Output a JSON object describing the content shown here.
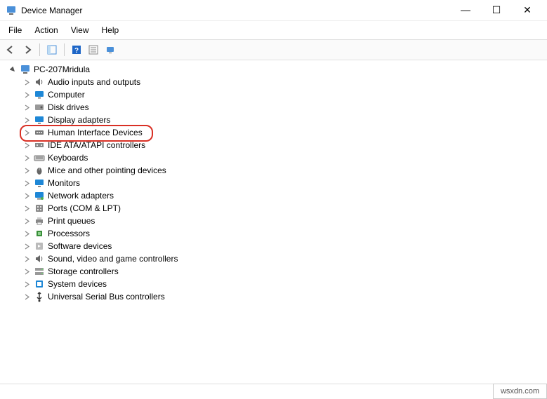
{
  "title": "Device Manager",
  "menu": {
    "file": "File",
    "action": "Action",
    "view": "View",
    "help": "Help"
  },
  "root": "PC-207Mridula",
  "nodes": [
    {
      "label": "Audio inputs and outputs",
      "icon": "audio"
    },
    {
      "label": "Computer",
      "icon": "monitor"
    },
    {
      "label": "Disk drives",
      "icon": "disk"
    },
    {
      "label": "Display adapters",
      "icon": "monitor"
    },
    {
      "label": "Human Interface Devices",
      "icon": "hid",
      "highlight": true
    },
    {
      "label": "IDE ATA/ATAPI controllers",
      "icon": "ide"
    },
    {
      "label": "Keyboards",
      "icon": "keyboard"
    },
    {
      "label": "Mice and other pointing devices",
      "icon": "mouse"
    },
    {
      "label": "Monitors",
      "icon": "monitor"
    },
    {
      "label": "Network adapters",
      "icon": "network"
    },
    {
      "label": "Ports (COM & LPT)",
      "icon": "port"
    },
    {
      "label": "Print queues",
      "icon": "printer"
    },
    {
      "label": "Processors",
      "icon": "cpu"
    },
    {
      "label": "Software devices",
      "icon": "software"
    },
    {
      "label": "Sound, video and game controllers",
      "icon": "audio"
    },
    {
      "label": "Storage controllers",
      "icon": "storage"
    },
    {
      "label": "System devices",
      "icon": "system"
    },
    {
      "label": "Universal Serial Bus controllers",
      "icon": "usb"
    }
  ],
  "watermark": "wsxdn.com"
}
